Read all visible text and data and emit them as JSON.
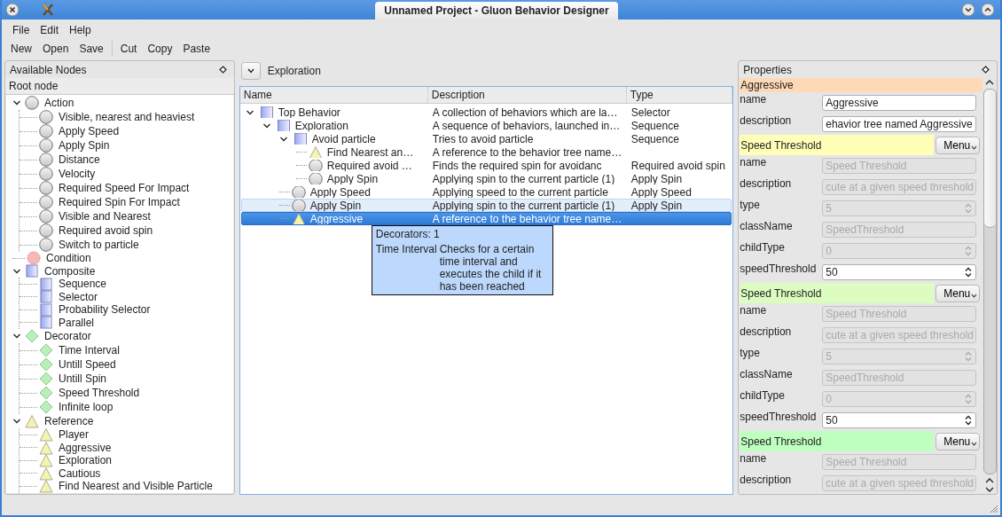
{
  "window": {
    "title": "Unnamed Project - Gluon Behavior Designer"
  },
  "menu": [
    "File",
    "Edit",
    "Help"
  ],
  "toolbar": [
    [
      "New",
      "Open",
      "Save"
    ],
    [
      "Cut",
      "Copy",
      "Paste"
    ]
  ],
  "nodes_panel": {
    "title": "Available Nodes",
    "header": "Root node",
    "tree": [
      {
        "kind": "action",
        "label": "Action",
        "expanded": true,
        "children": [
          {
            "kind": "action",
            "label": "Visible, nearest and heaviest"
          },
          {
            "kind": "action",
            "label": "Apply Speed"
          },
          {
            "kind": "action",
            "label": "Apply Spin"
          },
          {
            "kind": "action",
            "label": "Distance"
          },
          {
            "kind": "action",
            "label": "Velocity"
          },
          {
            "kind": "action",
            "label": "Required Speed For Impact"
          },
          {
            "kind": "action",
            "label": "Required Spin For Impact"
          },
          {
            "kind": "action",
            "label": "Visible and Nearest"
          },
          {
            "kind": "action",
            "label": "Required avoid spin"
          },
          {
            "kind": "action",
            "label": "Switch to particle"
          }
        ]
      },
      {
        "kind": "condition",
        "label": "Condition"
      },
      {
        "kind": "composite",
        "label": "Composite",
        "expanded": true,
        "children": [
          {
            "kind": "composite",
            "label": "Sequence"
          },
          {
            "kind": "composite",
            "label": "Selector"
          },
          {
            "kind": "composite",
            "label": "Probability Selector"
          },
          {
            "kind": "composite",
            "label": "Parallel"
          }
        ]
      },
      {
        "kind": "decorator",
        "label": "Decorator",
        "expanded": true,
        "children": [
          {
            "kind": "decorator",
            "label": "Time Interval"
          },
          {
            "kind": "decorator",
            "label": "Untill Speed"
          },
          {
            "kind": "decorator",
            "label": "Untill Spin"
          },
          {
            "kind": "decorator",
            "label": "Speed Threshold"
          },
          {
            "kind": "decorator",
            "label": "Infinite loop"
          }
        ]
      },
      {
        "kind": "reference",
        "label": "Reference",
        "expanded": true,
        "children": [
          {
            "kind": "reference",
            "label": "Player"
          },
          {
            "kind": "reference",
            "label": "Aggressive"
          },
          {
            "kind": "reference",
            "label": "Exploration"
          },
          {
            "kind": "reference",
            "label": "Cautious"
          },
          {
            "kind": "reference",
            "label": "Find Nearest and Visible Particle"
          }
        ]
      }
    ]
  },
  "behavior_panel": {
    "breadcrumb": "Exploration",
    "columns": [
      "Name",
      "Description",
      "Type"
    ],
    "rows": [
      {
        "kind": "composite",
        "name": "Top Behavior",
        "description": "A collection of behaviors which are la…",
        "type": "Selector",
        "expanded": true,
        "selected": false,
        "hovered": false,
        "children": [
          {
            "kind": "composite",
            "name": "Exploration",
            "description": "A sequence of behaviors, launched in…",
            "type": "Sequence",
            "expanded": true,
            "selected": false,
            "hovered": false,
            "children": [
              {
                "kind": "composite",
                "name": "Avoid particle",
                "description": "Tries to avoid particle",
                "type": "Sequence",
                "expanded": true,
                "selected": false,
                "hovered": false,
                "children": [
                  {
                    "kind": "reference",
                    "name": "Find Nearest an…",
                    "description": "A reference to the behavior tree name…",
                    "selected": false,
                    "hovered": false
                  },
                  {
                    "kind": "action",
                    "name": "Required avoid …",
                    "description": "Finds the required spin for avoidanc",
                    "type": "Required avoid spin",
                    "selected": false,
                    "hovered": false
                  },
                  {
                    "kind": "action",
                    "name": "Apply Spin",
                    "description": "Applying spin to the current particle (1)",
                    "type": "Apply Spin",
                    "selected": false,
                    "hovered": false
                  }
                ]
              },
              {
                "kind": "action",
                "name": "Apply Speed",
                "description": "Applying speed to the current particle",
                "type": "Apply Speed",
                "selected": false,
                "hovered": false
              },
              {
                "kind": "action",
                "name": "Apply Spin",
                "description": "Applying spin to the current particle (1)",
                "type": "Apply Spin",
                "selected": false,
                "hovered": true
              },
              {
                "kind": "reference",
                "name": "Aggressive",
                "description": "A reference to the behavior tree name…",
                "selected": true,
                "hovered": false
              }
            ]
          }
        ]
      }
    ],
    "tooltip": {
      "heading": "Decorators: 1",
      "items": [
        {
          "name": "Time Interval",
          "description": "Checks for a certain time interval and executes the child if it has been reached"
        }
      ]
    }
  },
  "properties_panel": {
    "title": "Properties",
    "sections": [
      {
        "title": "Aggressive",
        "color": "#fdd9b5",
        "fields": [
          {
            "label": "name",
            "value": "Aggressive",
            "kind": "text",
            "disabled": false
          },
          {
            "label": "description",
            "value": "ehavior tree named Aggressive",
            "kind": "text",
            "disabled": false
          }
        ]
      },
      {
        "title": "Speed Threshold",
        "color": "#ffffb8",
        "menu": "Menu",
        "fields": [
          {
            "label": "name",
            "value": "Speed Threshold",
            "kind": "text",
            "disabled": true
          },
          {
            "label": "description",
            "value": "cute at a given speed threshold",
            "kind": "text",
            "disabled": true
          },
          {
            "label": "type",
            "value": "5",
            "kind": "spin",
            "disabled": true
          },
          {
            "label": "className",
            "value": "SpeedThreshold",
            "kind": "text",
            "disabled": true
          },
          {
            "label": "childType",
            "value": "0",
            "kind": "spin",
            "disabled": true
          },
          {
            "label": "speedThreshold",
            "value": "50",
            "kind": "spin",
            "disabled": false
          }
        ]
      },
      {
        "title": "Speed Threshold",
        "color": "#ddfdc0",
        "menu": "Menu",
        "fields": [
          {
            "label": "name",
            "value": "Speed Threshold",
            "kind": "text",
            "disabled": true
          },
          {
            "label": "description",
            "value": "cute at a given speed threshold",
            "kind": "text",
            "disabled": true
          },
          {
            "label": "type",
            "value": "5",
            "kind": "spin",
            "disabled": true
          },
          {
            "label": "className",
            "value": "SpeedThreshold",
            "kind": "text",
            "disabled": true
          },
          {
            "label": "childType",
            "value": "0",
            "kind": "spin",
            "disabled": true
          },
          {
            "label": "speedThreshold",
            "value": "50",
            "kind": "spin",
            "disabled": false
          }
        ]
      },
      {
        "title": "Speed Threshold",
        "color": "#bfffbf",
        "menu": "Menu",
        "fields": [
          {
            "label": "name",
            "value": "Speed Threshold",
            "kind": "text",
            "disabled": true
          },
          {
            "label": "description",
            "value": "cute at a given speed threshold",
            "kind": "text",
            "disabled": true
          }
        ]
      }
    ]
  }
}
